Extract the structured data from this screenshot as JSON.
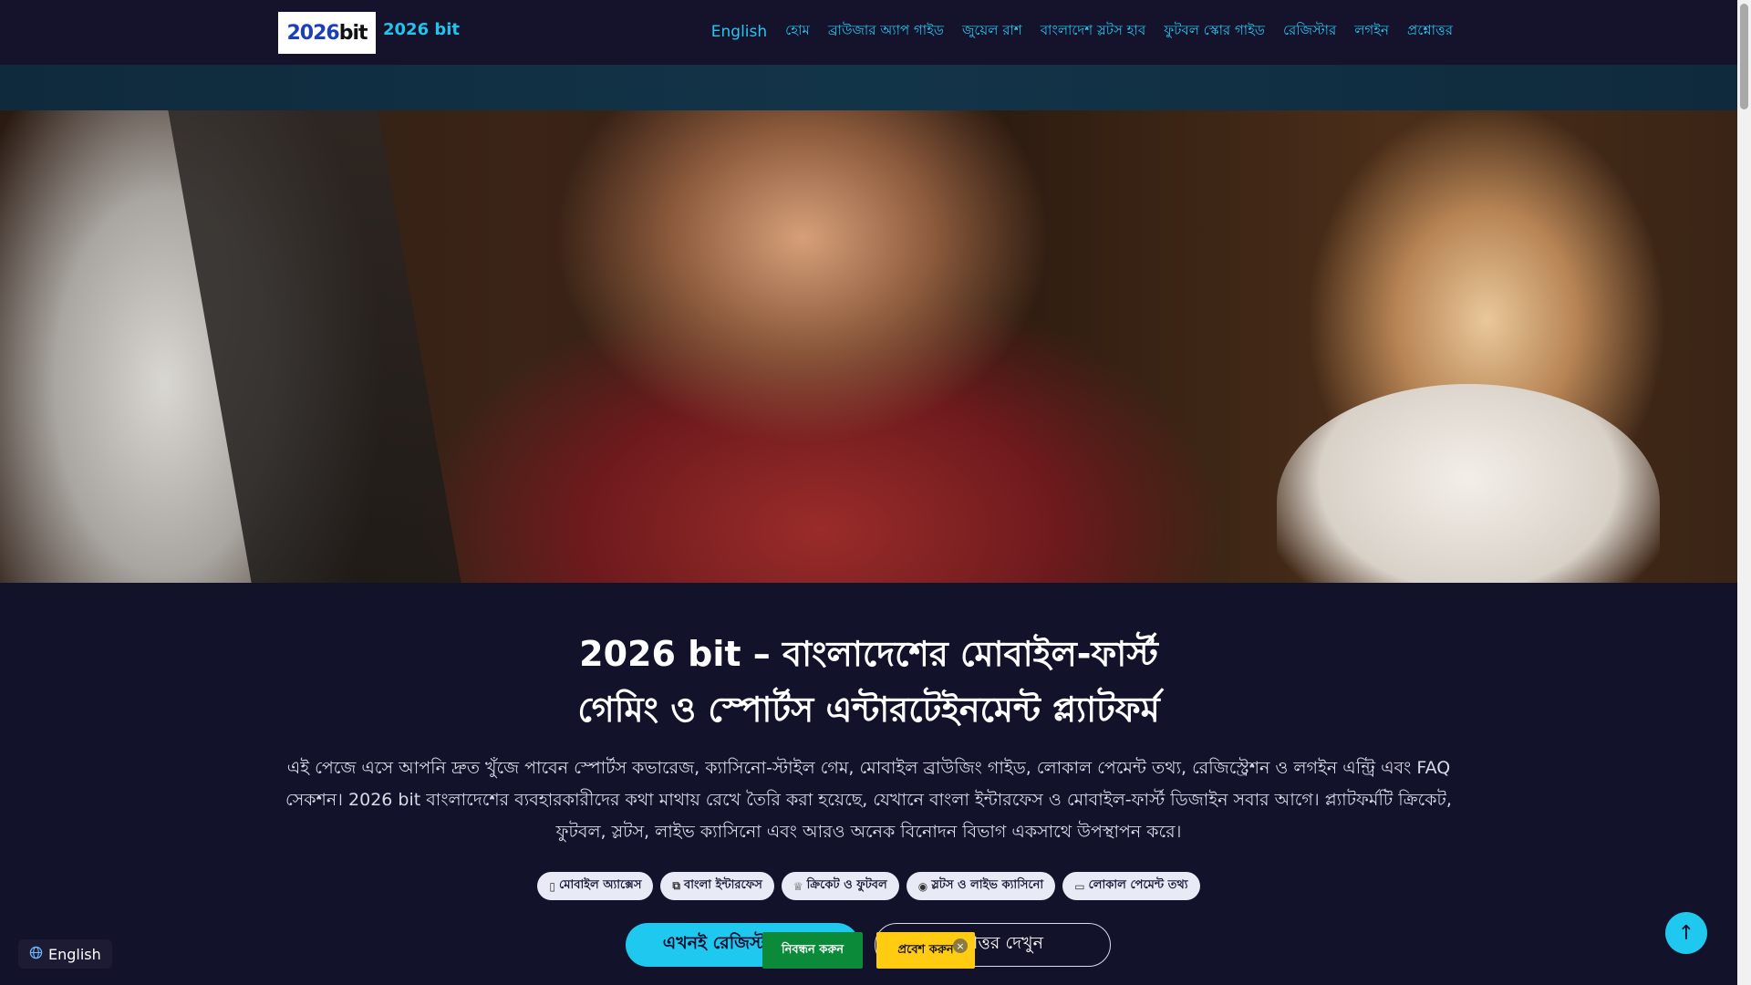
{
  "header": {
    "logo": {
      "num": "2026",
      "bit": "bit"
    },
    "brand": "2026 bit",
    "nav": [
      {
        "label": "English"
      },
      {
        "label": "হোম"
      },
      {
        "label": "ব্রাউজার অ্যাপ গাইড"
      },
      {
        "label": "জুয়েল রাশ"
      },
      {
        "label": "বাংলাদেশ স্লটস হাব"
      },
      {
        "label": "ফুটবল স্কোর গাইড"
      },
      {
        "label": "রেজিস্টার"
      },
      {
        "label": "লগইন"
      },
      {
        "label": "প্রশ্নোত্তর"
      }
    ]
  },
  "hero": {
    "title_line1": "2026 bit – বাংলাদেশের মোবাইল-ফার্স্ট",
    "title_line2": "গেমিং ও স্পোর্টস এন্টারটেইনমেন্ট প্ল্যাটফর্ম",
    "lead": "এই পেজে এসে আপনি দ্রুত খুঁজে পাবেন স্পোর্টস কভারেজ, ক্যাসিনো-স্টাইল গেম, মোবাইল ব্রাউজিং গাইড, লোকাল পেমেন্ট তথ্য, রেজিস্ট্রেশন ও লগইন এন্ট্রি এবং FAQ সেকশন। 2026 bit বাংলাদেশের ব্যবহারকারীদের কথা মাথায় রেখে তৈরি করা হয়েছে, যেখানে বাংলা ইন্টারফেস ও মোবাইল-ফার্স্ট ডিজাইন সবার আগে। প্ল্যাটফর্মটি ক্রিকেট, ফুটবল, স্লটস, লাইভ ক্যাসিনো এবং আরও অনেক বিনোদন বিভাগ একসাথে উপস্থাপন করে।",
    "chips": [
      {
        "icon": "mobile-icon",
        "glyph": "▯",
        "label": "মোবাইল অ্যাক্সেস"
      },
      {
        "icon": "translate-icon",
        "glyph": "⧉",
        "label": "বাংলা ইন্টারফেস"
      },
      {
        "icon": "trophy-icon",
        "glyph": "♕",
        "label": "ক্রিকেট ও ফুটবল"
      },
      {
        "icon": "gamepad-icon",
        "glyph": "◉",
        "label": "স্লটস ও লাইভ ক্যাসিনো"
      },
      {
        "icon": "card-icon",
        "glyph": "▭",
        "label": "লোকাল পেমেন্ট তথ্য"
      }
    ],
    "cta_primary": "এখনই রেজিস্টার করুন",
    "cta_secondary": "প্রশ্নোত্তর দেখুন"
  },
  "sticky": {
    "register": "নিবন্ধন করুন",
    "login": "প্রবেশ করুন",
    "close": "×"
  },
  "lang_switch": {
    "label": "English",
    "icon": "globe-icon"
  },
  "to_top": {
    "icon": "arrow-up-icon",
    "glyph": "↑"
  },
  "colors": {
    "accent": "#1fc8ee",
    "background": "#13122b",
    "register_green": "#0b8a3a",
    "login_yellow": "#ffcc11"
  }
}
